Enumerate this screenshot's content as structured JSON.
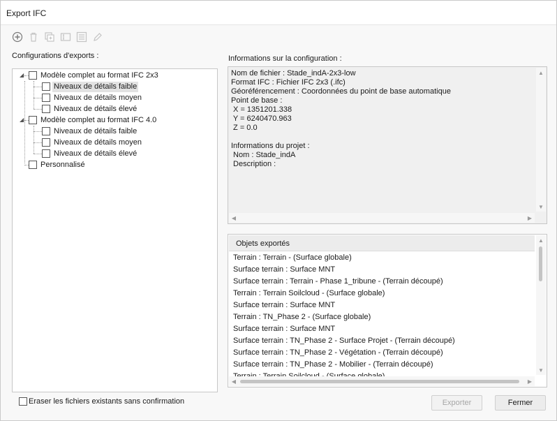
{
  "window": {
    "title": "Export IFC"
  },
  "toolbar": {
    "buttons": [
      {
        "icon": "add-icon"
      },
      {
        "icon": "delete-icon"
      },
      {
        "icon": "duplicate-icon"
      },
      {
        "icon": "rename-icon"
      },
      {
        "icon": "properties-icon"
      },
      {
        "icon": "edit-icon"
      }
    ]
  },
  "left": {
    "label": "Configurations d'exports :",
    "tree": [
      {
        "label": "Modèle complet au format IFC 2x3",
        "level": 0,
        "expanded": true,
        "checked": false
      },
      {
        "label": "Niveaux de détails faible",
        "level": 1,
        "checked": false,
        "selected": true
      },
      {
        "label": "Niveaux de détails moyen",
        "level": 1,
        "checked": false
      },
      {
        "label": "Niveaux de détails élevé",
        "level": 1,
        "checked": false
      },
      {
        "label": "Modèle complet au format IFC 4.0",
        "level": 0,
        "expanded": true,
        "checked": false
      },
      {
        "label": "Niveaux de détails faible",
        "level": 1,
        "checked": false
      },
      {
        "label": "Niveaux de détails moyen",
        "level": 1,
        "checked": false
      },
      {
        "label": "Niveaux de détails élevé",
        "level": 1,
        "checked": false
      },
      {
        "label": "Personnalisé",
        "level": 0,
        "checked": false
      }
    ]
  },
  "info": {
    "label": "Informations sur la configuration :",
    "text": "Nom de fichier : Stade_indA-2x3-low\nFormat IFC : Fichier IFC 2x3 (.ifc)\nGéoréférencement : Coordonnées du point de base automatique\nPoint de base :\n X = 1351201.338\n Y = 6240470.963\n Z = 0.0\n\nInformations du projet :\n Nom : Stade_indA\n Description :"
  },
  "objects": {
    "header": "Objets exportés",
    "rows": [
      "Terrain : Terrain - (Surface globale)",
      "Surface terrain : Surface MNT",
      "Surface terrain : Terrain - Phase 1_tribune - (Terrain découpé)",
      "Terrain : Terrain Soilcloud - (Surface globale)",
      "Surface terrain : Surface MNT",
      "Terrain : TN_Phase 2 - (Surface globale)",
      "Surface terrain : Surface MNT",
      "Surface terrain : TN_Phase 2 - Surface Projet - (Terrain découpé)",
      "Surface terrain : TN_Phase 2 - Végétation - (Terrain découpé)",
      "Surface terrain : TN_Phase 2 - Mobilier - (Terrain découpé)",
      "Terrain : Terrain Soilcloud - (Surface globale)"
    ]
  },
  "footer": {
    "overwrite_label": "Eraser les fichiers existants sans confirmation",
    "overwrite_checked": false,
    "export_label": "Exporter",
    "close_label": "Fermer"
  }
}
